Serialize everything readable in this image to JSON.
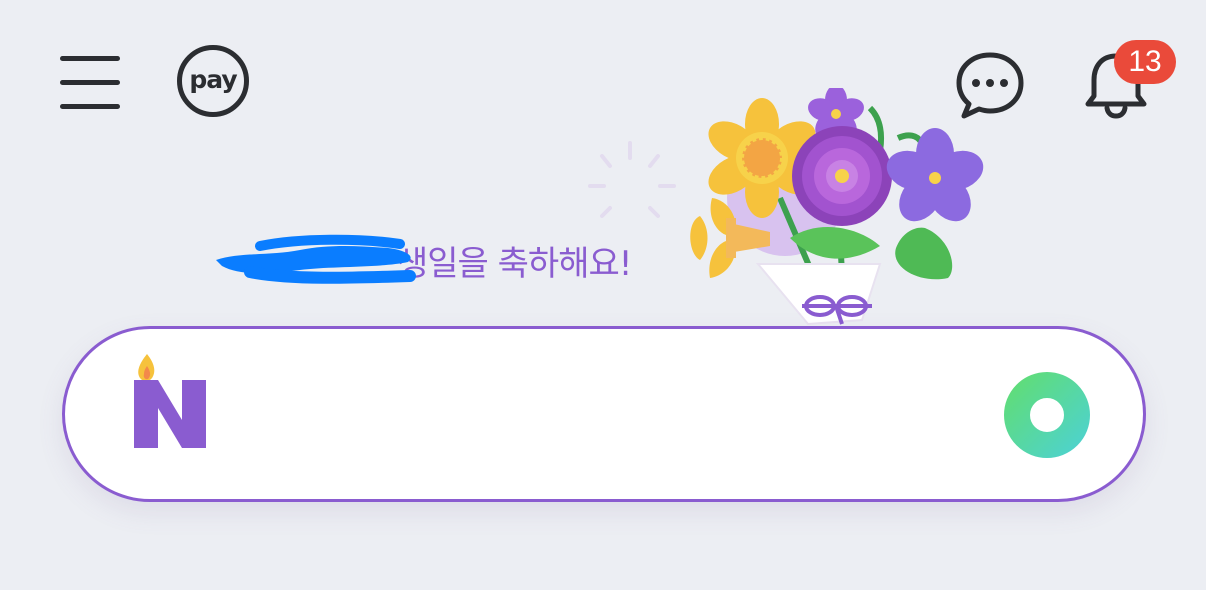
{
  "header": {
    "menu_icon": "hamburger-menu-icon",
    "pay_label": "pay",
    "chat_icon": "chat-bubble-icon",
    "bell_icon": "bell-icon",
    "notification_count": "13"
  },
  "greeting": {
    "text": "생일을 축하해요!",
    "illustration": "flower-bouquet"
  },
  "search": {
    "value": "",
    "placeholder": "",
    "logo_icon": "naver-birthday-candle-logo",
    "action_icon": "green-ring-icon"
  },
  "colors": {
    "background": "#eceef3",
    "accent_purple": "#8a5cd0",
    "badge_red": "#ea4a3a",
    "icon_dark": "#2b2d31",
    "green": "#5fdc7c",
    "redaction_blue": "#0a7dff"
  }
}
